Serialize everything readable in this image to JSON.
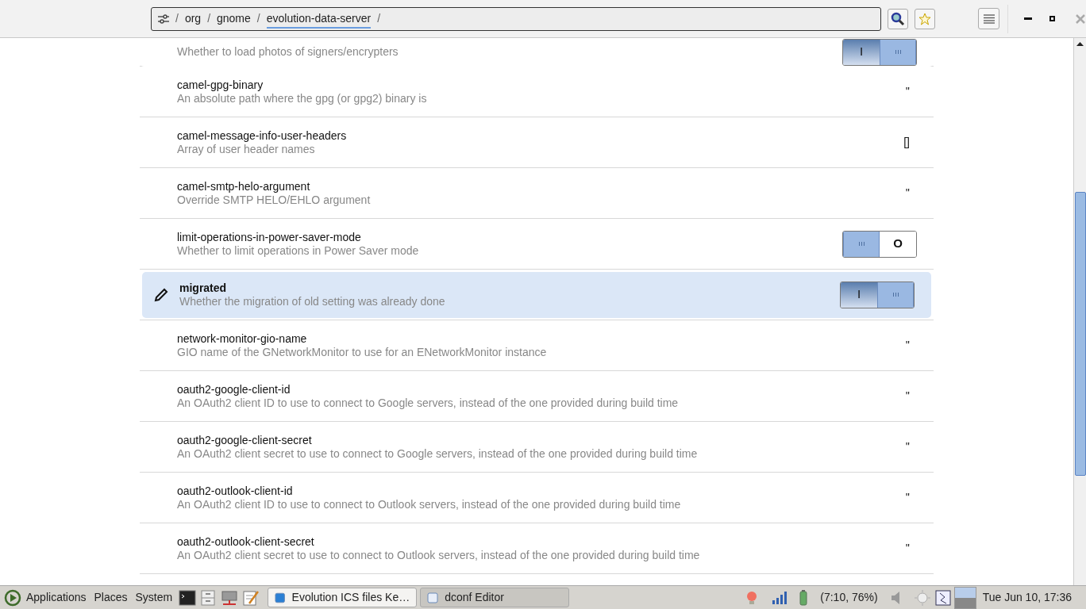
{
  "path_bar": {
    "segments": [
      {
        "label": "org",
        "selected": false
      },
      {
        "label": "gnome",
        "selected": false
      },
      {
        "label": "evolution-data-server",
        "selected": true
      }
    ],
    "separator": "/"
  },
  "keys": [
    {
      "description": "Whether to load photos of signers/encrypters",
      "kind": "toggle",
      "on": true,
      "value": "I",
      "selected": false
    },
    {
      "name": "camel-gpg-binary",
      "description": "An absolute path where the gpg (or gpg2) binary is",
      "kind": "text",
      "value": "''",
      "selected": false
    },
    {
      "name": "camel-message-info-user-headers",
      "description": "Array of user header names",
      "kind": "text",
      "value": "[]",
      "selected": false
    },
    {
      "name": "camel-smtp-helo-argument",
      "description": "Override SMTP HELO/EHLO argument",
      "kind": "text",
      "value": "''",
      "selected": false
    },
    {
      "name": "limit-operations-in-power-saver-mode",
      "description": "Whether to limit operations in Power Saver mode",
      "kind": "toggle",
      "on": false,
      "value": "O",
      "selected": false
    },
    {
      "name": "migrated",
      "description": "Whether the migration of old setting was already done",
      "kind": "toggle",
      "on": true,
      "value": "I",
      "selected": true
    },
    {
      "name": "network-monitor-gio-name",
      "description": "GIO name of the GNetworkMonitor to use for an ENetworkMonitor instance",
      "kind": "text",
      "value": "''",
      "selected": false
    },
    {
      "name": "oauth2-google-client-id",
      "description": "An OAuth2 client ID to use to connect to Google servers, instead of the one provided during build time",
      "kind": "text",
      "value": "''",
      "selected": false
    },
    {
      "name": "oauth2-google-client-secret",
      "description": "An OAuth2 client secret to use to connect to Google servers, instead of the one provided during build time",
      "kind": "text",
      "value": "''",
      "selected": false
    },
    {
      "name": "oauth2-outlook-client-id",
      "description": "An OAuth2 client ID to use to connect to Outlook servers, instead of the one provided during build time",
      "kind": "text",
      "value": "''",
      "selected": false
    },
    {
      "name": "oauth2-outlook-client-secret",
      "description": "An OAuth2 client secret to use to connect to Outlook servers, instead of the one provided during build time",
      "kind": "text",
      "value": "''",
      "selected": false
    }
  ],
  "taskbar": {
    "menus": [
      "Applications",
      "Places",
      "System"
    ],
    "windows": [
      {
        "label": "Evolution ICS files Ke…",
        "selected": false
      },
      {
        "label": "dconf Editor",
        "selected": true
      }
    ],
    "battery": "(7:10, 76%)",
    "clock": "Tue Jun 10, 17:36"
  }
}
